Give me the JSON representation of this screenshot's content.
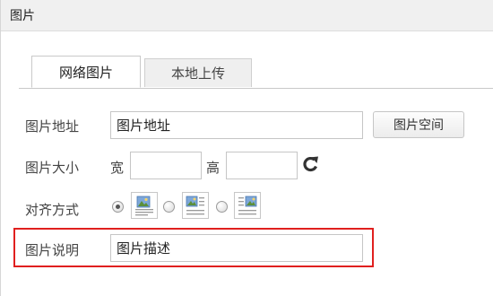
{
  "window": {
    "title": "图片"
  },
  "tabs": [
    {
      "label": "网络图片",
      "active": true
    },
    {
      "label": "本地上传",
      "active": false
    }
  ],
  "form": {
    "url": {
      "label": "图片地址",
      "value": "图片地址"
    },
    "space_button": "图片空间",
    "size": {
      "label": "图片大小",
      "width_label": "宽",
      "height_label": "高",
      "width_value": "",
      "height_value": ""
    },
    "align": {
      "label": "对齐方式",
      "selected": "default",
      "options": [
        "default",
        "left",
        "right"
      ]
    },
    "description": {
      "label": "图片说明",
      "value": "图片描述"
    }
  },
  "colors": {
    "highlight": "#e0201f"
  },
  "icons": [
    "refresh-icon",
    "align-default-icon",
    "align-left-icon",
    "align-right-icon"
  ]
}
